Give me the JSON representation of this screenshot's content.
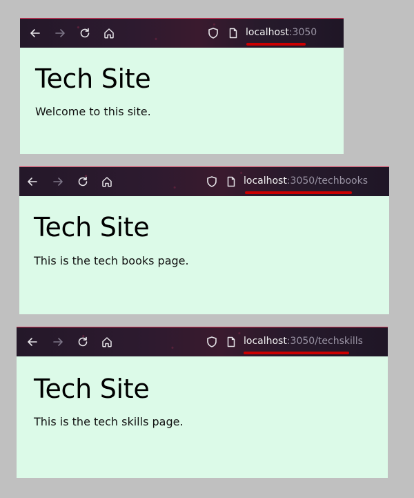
{
  "windows": [
    {
      "url_host": "localhost",
      "url_rest": ":3050",
      "heading": "Tech Site",
      "paragraph": "Welcome to this site."
    },
    {
      "url_host": "localhost",
      "url_rest": ":3050/techbooks",
      "heading": "Tech Site",
      "paragraph": "This is the tech books page."
    },
    {
      "url_host": "localhost",
      "url_rest": ":3050/techskills",
      "heading": "Tech Site",
      "paragraph": "This is the tech skills page."
    }
  ],
  "colors": {
    "background": "#c0c0c0",
    "toolbar": "#241829",
    "page_background": "#dcfae8",
    "underline": "#cc0000",
    "url_host": "#f2f2f2",
    "url_path": "#9a94a4"
  },
  "icons": [
    "back-arrow-icon",
    "forward-arrow-icon",
    "reload-icon",
    "home-icon",
    "shield-icon",
    "page-icon"
  ]
}
